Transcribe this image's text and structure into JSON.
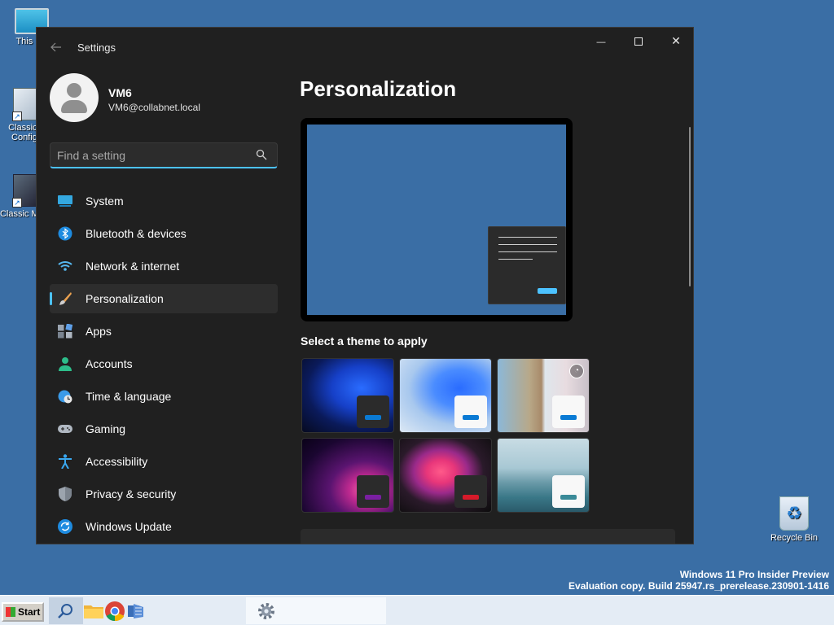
{
  "desktop": {
    "icons": [
      {
        "label": "This PC",
        "icon": "monitor-icon"
      },
      {
        "label": "Classic S Configu",
        "icon": "config-icon"
      },
      {
        "label": "Classic Mana",
        "icon": "manager-icon"
      },
      {
        "label": "Recycle Bin",
        "icon": "recycle-bin-icon"
      }
    ],
    "watermark": {
      "line1": "Windows 11 Pro Insider Preview",
      "line2": "Evaluation copy. Build 25947.rs_prerelease.230901-1416"
    },
    "background": "#3a6ea5"
  },
  "window": {
    "title": "Settings",
    "controls": {
      "minimize": "—",
      "close": "✕"
    },
    "user": {
      "name": "VM6",
      "email": "VM6@collabnet.local"
    },
    "search": {
      "placeholder": "Find a setting"
    },
    "nav": [
      {
        "label": "System",
        "icon": "system-icon"
      },
      {
        "label": "Bluetooth & devices",
        "icon": "bluetooth-icon"
      },
      {
        "label": "Network & internet",
        "icon": "wifi-icon"
      },
      {
        "label": "Personalization",
        "icon": "brush-icon",
        "active": true
      },
      {
        "label": "Apps",
        "icon": "apps-icon"
      },
      {
        "label": "Accounts",
        "icon": "accounts-icon"
      },
      {
        "label": "Time & language",
        "icon": "globe-clock-icon"
      },
      {
        "label": "Gaming",
        "icon": "gamepad-icon"
      },
      {
        "label": "Accessibility",
        "icon": "accessibility-icon"
      },
      {
        "label": "Privacy & security",
        "icon": "shield-icon"
      },
      {
        "label": "Windows Update",
        "icon": "update-icon"
      }
    ],
    "main": {
      "title": "Personalization",
      "theme_heading": "Select a theme to apply",
      "themes": [
        {
          "name": "dark-bloom",
          "accent": "#0a7ad4"
        },
        {
          "name": "light-bloom",
          "accent": "#0a7ad4"
        },
        {
          "name": "spotlight",
          "accent": "#0a7ad4"
        },
        {
          "name": "glow",
          "accent": "#7a1fa2"
        },
        {
          "name": "captured-motion",
          "accent": "#d61a2a"
        },
        {
          "name": "flow",
          "accent": "#3a8a98"
        }
      ]
    },
    "accent_color": "#4cc2ff"
  },
  "taskbar": {
    "start_label": "Start",
    "apps": [
      "search-icon",
      "file-explorer-icon",
      "chrome-icon",
      "server-manager-icon",
      "settings-gear-icon"
    ]
  }
}
